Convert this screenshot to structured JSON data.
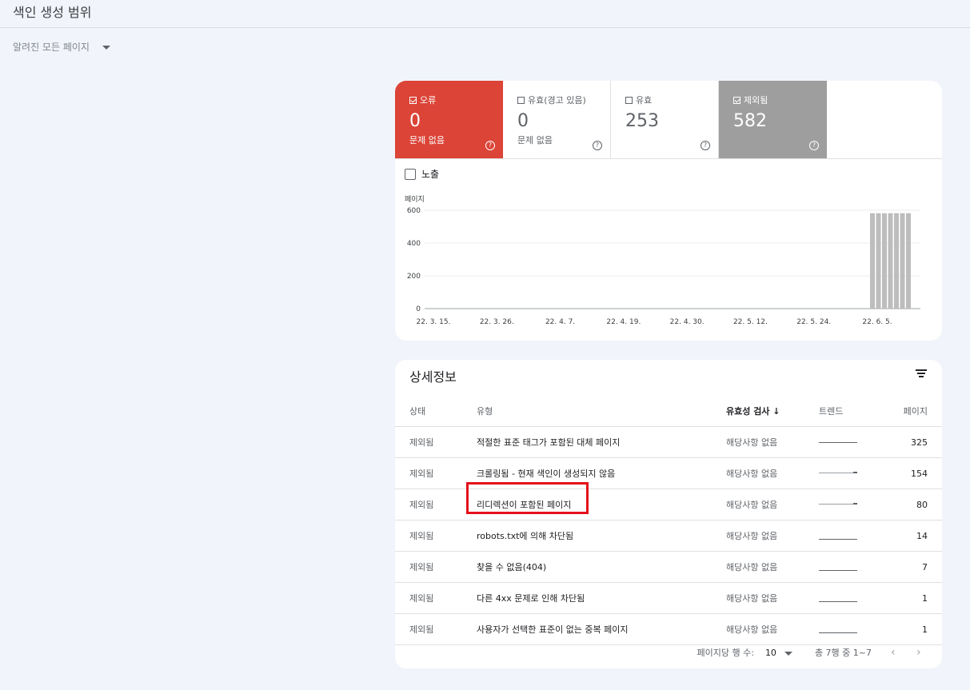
{
  "page": {
    "title": "색인 생성 범위",
    "filter_label": "알려진 모든 페이지"
  },
  "summary": {
    "tiles": [
      {
        "label": "오류",
        "value": "0",
        "sub": "문제 없음",
        "checked": true,
        "color": "#db4437"
      },
      {
        "label": "유효(경고 있음)",
        "value": "0",
        "sub": "문제 없음",
        "checked": false,
        "color": "#ffffff"
      },
      {
        "label": "유효",
        "value": "253",
        "sub": "",
        "checked": false,
        "color": "#ffffff"
      },
      {
        "label": "제외됨",
        "value": "582",
        "sub": "",
        "checked": true,
        "color": "#9e9e9e"
      }
    ],
    "impressions_label": "노출",
    "help_glyph": "?"
  },
  "chart_data": {
    "type": "bar",
    "ylabel": "페이지",
    "ylim": [
      0,
      600
    ],
    "yticks": [
      0,
      200,
      400,
      600
    ],
    "x_tick_labels": [
      "22. 3. 15.",
      "22. 3. 26.",
      "22. 4. 7.",
      "22. 4. 19.",
      "22. 4. 30.",
      "22. 5. 12.",
      "22. 5. 24.",
      "22. 6. 5."
    ],
    "series": [
      {
        "color": "#bdbdbd",
        "categories": [
          "22. 6. 1.",
          "22. 6. 2.",
          "22. 6. 3.",
          "22. 6. 4.",
          "22. 6. 5.",
          "22. 6. 6.",
          "22. 6. 7."
        ],
        "values": [
          582,
          582,
          582,
          582,
          582,
          582,
          582
        ]
      }
    ]
  },
  "details": {
    "title": "상세정보",
    "columns": {
      "status": "상태",
      "type": "유형",
      "validation": "유효성 검사",
      "sort_arrow": "↓",
      "trend": "트렌드",
      "pages": "페이지"
    },
    "rows": [
      {
        "status": "제외됨",
        "type": "적절한 표준 태그가 포함된 대체 페이지",
        "validation": "해당사항 없음",
        "trend": "flat-high",
        "pages": "325"
      },
      {
        "status": "제외됨",
        "type": "크롤링됨 - 현재 색인이 생성되지 않음",
        "validation": "해당사항 없음",
        "trend": "flat-mid",
        "pages": "154"
      },
      {
        "status": "제외됨",
        "type": "리디렉션이 포함된 페이지",
        "validation": "해당사항 없음",
        "trend": "flat-mid",
        "pages": "80"
      },
      {
        "status": "제외됨",
        "type": "robots.txt에 의해 차단됨",
        "validation": "해당사항 없음",
        "trend": "flat-low",
        "pages": "14"
      },
      {
        "status": "제외됨",
        "type": "찾을 수 없음(404)",
        "validation": "해당사항 없음",
        "trend": "flat-low",
        "pages": "7"
      },
      {
        "status": "제외됨",
        "type": "다른 4xx 문제로 인해 차단됨",
        "validation": "해당사항 없음",
        "trend": "flat-low",
        "pages": "1"
      },
      {
        "status": "제외됨",
        "type": "사용자가 선택한 표준이 없는 중복 페이지",
        "validation": "해당사항 없음",
        "trend": "flat-low",
        "pages": "1"
      }
    ],
    "footer": {
      "rows_per_page_label": "페이지당 행 수:",
      "rows_per_page_value": "10",
      "range_text": "총 7행 중 1~7",
      "prev_glyph": "‹",
      "next_glyph": "›"
    }
  }
}
